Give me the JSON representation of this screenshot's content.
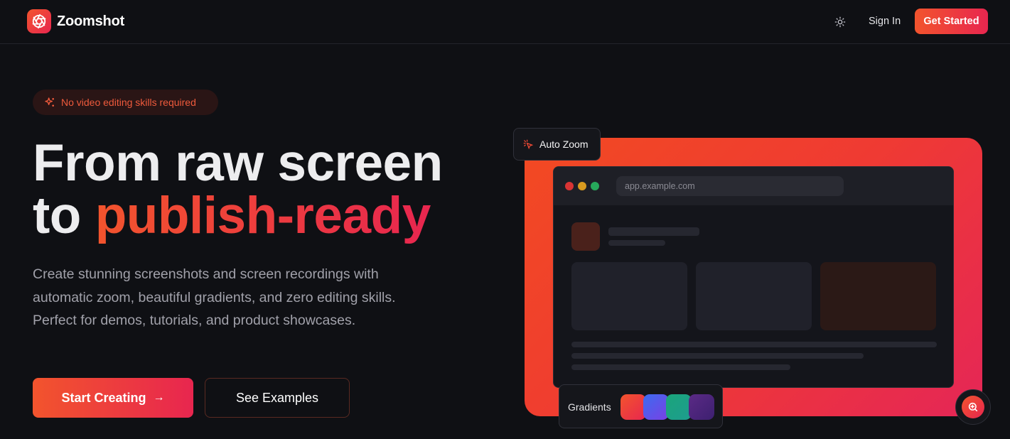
{
  "nav": {
    "brand": "Zoomshot",
    "sign_in": "Sign In",
    "get_started": "Get Started"
  },
  "hero": {
    "badge": "No video editing skills required",
    "headline_line1": "From raw screen",
    "headline_to": "to ",
    "headline_accent": "publish-ready",
    "description": "Create stunning screenshots and screen recordings with automatic zoom, beautiful gradients, and zero editing skills. Perfect for demos, tutorials, and product showcases.",
    "primary_cta": "Start Creating",
    "primary_cta_arrow": "→",
    "secondary_cta": "See Examples"
  },
  "preview": {
    "auto_zoom_label": "Auto Zoom",
    "url": "app.example.com",
    "gradients_label": "Gradients",
    "swatches": [
      {
        "name": "red-orange",
        "from": "#f2542d",
        "to": "#e8264f"
      },
      {
        "name": "blue-violet",
        "from": "#3b6cf0",
        "to": "#7b3fe4"
      },
      {
        "name": "teal-green",
        "from": "#1aa57a",
        "to": "#1e9c8f"
      },
      {
        "name": "purple",
        "from": "#5b2a86",
        "to": "#3d2070"
      }
    ]
  },
  "colors": {
    "accent_from": "#f2542d",
    "accent_to": "#e8264f",
    "background": "#0f1014"
  },
  "icons": {
    "logo": "aperture-icon",
    "theme": "sun-icon",
    "badge": "sparkles-icon",
    "auto_zoom": "cursor-click-icon",
    "arrow": "arrow-right-icon",
    "zoom": "zoom-in-icon"
  }
}
